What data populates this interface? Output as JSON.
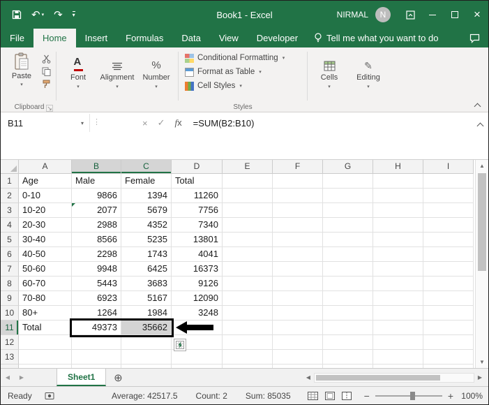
{
  "window": {
    "title": "Book1 - Excel",
    "user_name": "NIRMAL",
    "user_initial": "N"
  },
  "ribbon": {
    "tabs": [
      "File",
      "Home",
      "Insert",
      "Formulas",
      "Data",
      "View",
      "Developer"
    ],
    "active_tab": "Home",
    "tell_me": "Tell me what you want to do",
    "groups": {
      "paste_label": "Paste",
      "clipboard_label": "Clipboard",
      "font_label": "Font",
      "alignment_label": "Alignment",
      "number_label": "Number",
      "styles_label": "Styles",
      "styles_items": [
        "Conditional Formatting",
        "Format as Table",
        "Cell Styles"
      ],
      "cells_label": "Cells",
      "editing_label": "Editing"
    }
  },
  "formula_bar": {
    "name_box": "B11",
    "formula": "=SUM(B2:B10)"
  },
  "sheet": {
    "column_headers": [
      "A",
      "B",
      "C",
      "D",
      "E",
      "F",
      "G",
      "H",
      "I"
    ],
    "row_count": 14,
    "rows": [
      [
        "Age",
        "Male",
        "Female",
        "Total"
      ],
      [
        "0-10",
        "9866",
        "1394",
        "11260"
      ],
      [
        "10-20",
        "2077",
        "5679",
        "7756"
      ],
      [
        "20-30",
        "2988",
        "4352",
        "7340"
      ],
      [
        "30-40",
        "8566",
        "5235",
        "13801"
      ],
      [
        "40-50",
        "2298",
        "1743",
        "4041"
      ],
      [
        "50-60",
        "9948",
        "6425",
        "16373"
      ],
      [
        "60-70",
        "5443",
        "3683",
        "9126"
      ],
      [
        "70-80",
        "6923",
        "5167",
        "12090"
      ],
      [
        "80+",
        "1264",
        "1984",
        "3248"
      ],
      [
        "Total",
        "49373",
        "35662",
        ""
      ],
      [],
      [],
      []
    ],
    "selection": {
      "range": "B11:C11",
      "active_cell": "B11"
    }
  },
  "sheet_tabs": {
    "active": "Sheet1"
  },
  "status_bar": {
    "mode": "Ready",
    "average": "Average: 42517.5",
    "count": "Count: 2",
    "sum": "Sum: 85035",
    "zoom": "100%"
  }
}
